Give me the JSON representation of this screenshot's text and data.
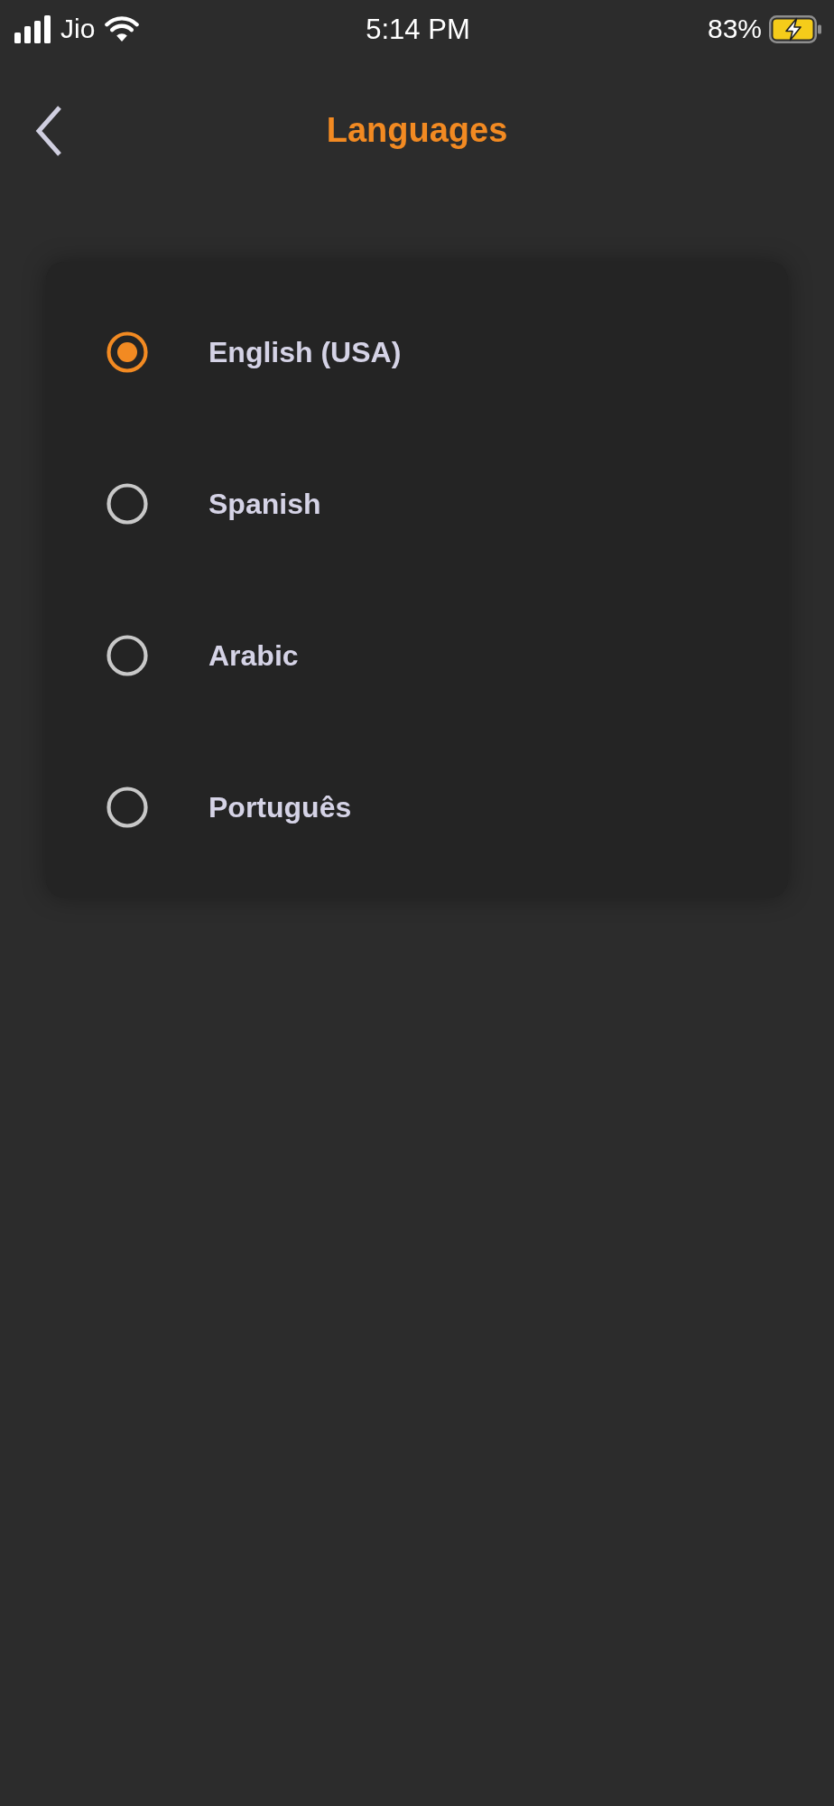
{
  "status_bar": {
    "carrier": "Jio",
    "time": "5:14 PM",
    "battery": "83%"
  },
  "header": {
    "title": "Languages"
  },
  "languages": [
    {
      "label": "English (USA)",
      "selected": true
    },
    {
      "label": "Spanish",
      "selected": false
    },
    {
      "label": "Arabic",
      "selected": false
    },
    {
      "label": "Português",
      "selected": false
    }
  ]
}
